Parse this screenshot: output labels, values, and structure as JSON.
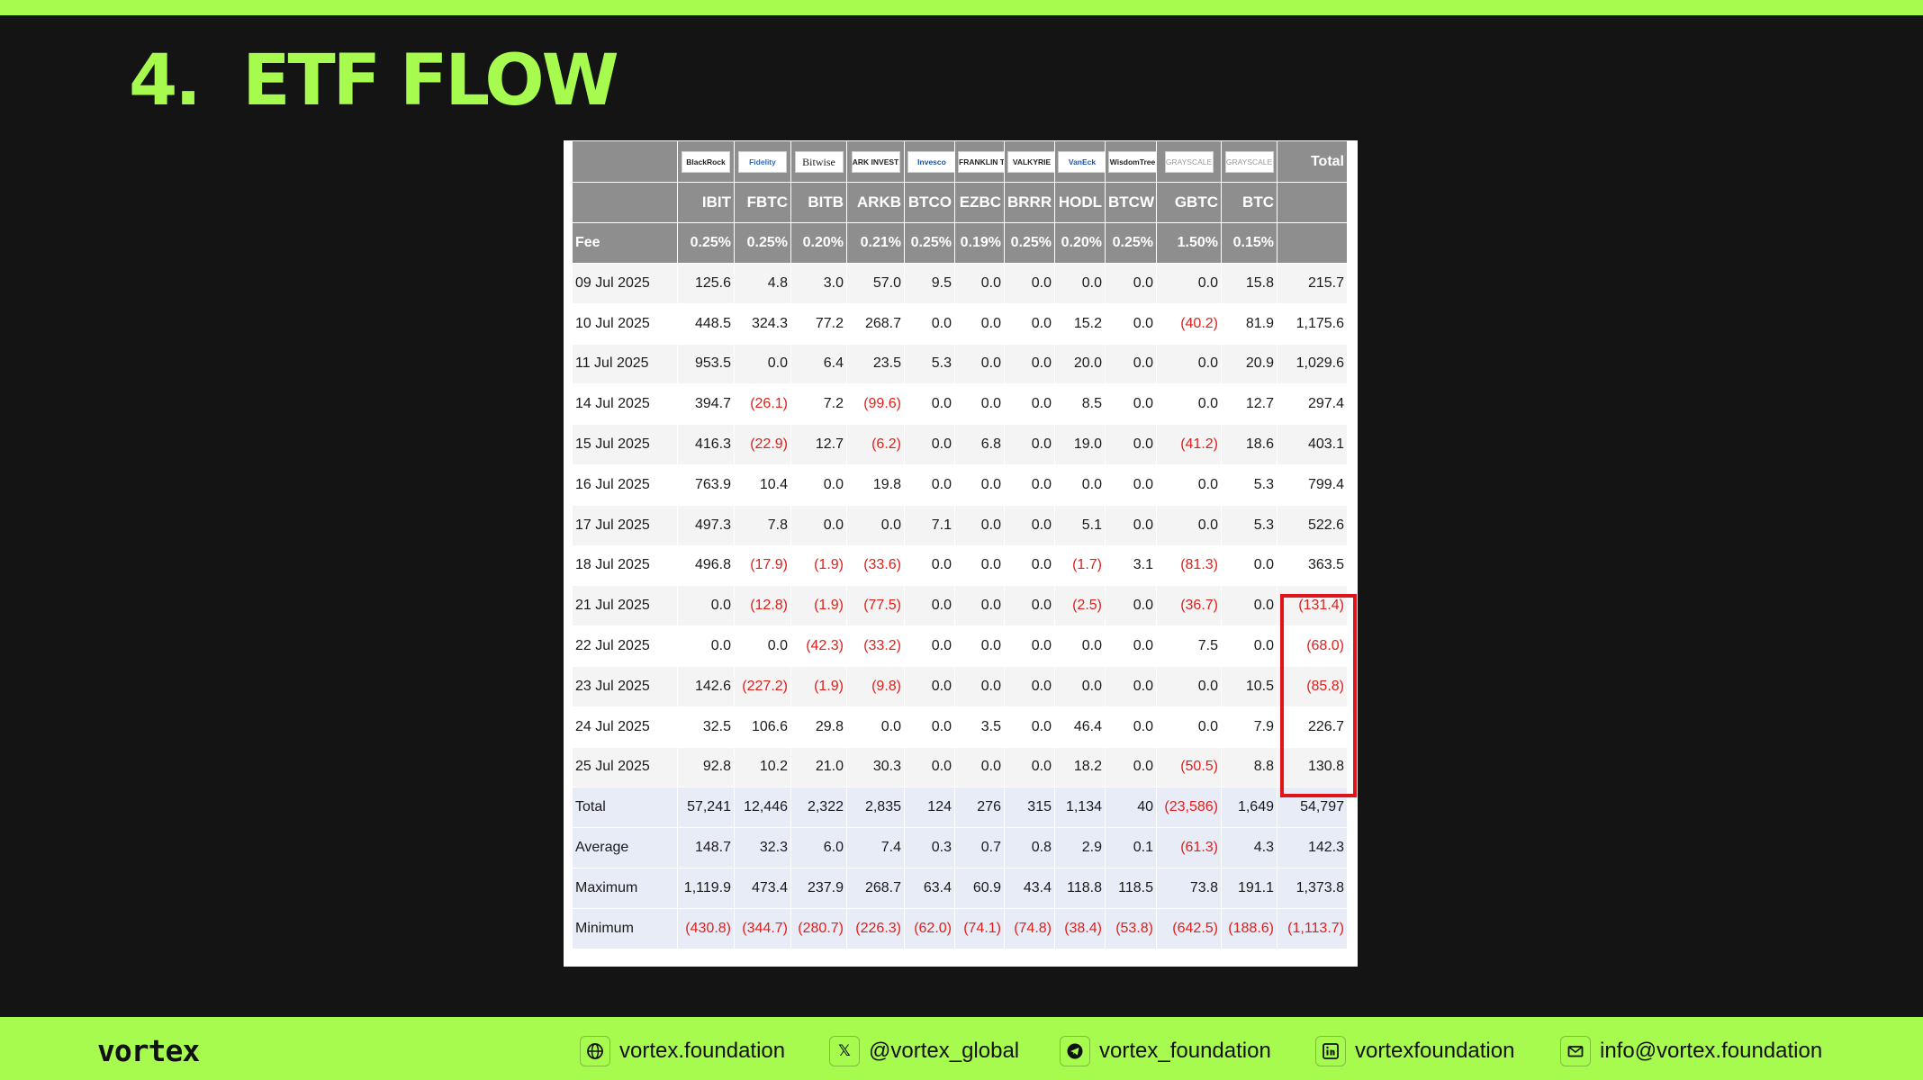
{
  "slide": {
    "title": "4.  ETF FLOW"
  },
  "table": {
    "logos": [
      "BlackRock",
      "Fidelity",
      "Bitwise",
      "ARK INVEST",
      "Invesco",
      "FRANKLIN TEMPLETON",
      "VALKYRIE",
      "VanEck",
      "WisdomTree",
      "GRAYSCALE",
      "GRAYSCALE"
    ],
    "total_header": "Total",
    "tickers": [
      "",
      "IBIT",
      "FBTC",
      "BITB",
      "ARKB",
      "BTCO",
      "EZBC",
      "BRRR",
      "HODL",
      "BTCW",
      "GBTC",
      "BTC",
      ""
    ],
    "fee_row": [
      "Fee",
      "0.25%",
      "0.25%",
      "0.20%",
      "0.21%",
      "0.25%",
      "0.19%",
      "0.25%",
      "0.20%",
      "0.25%",
      "1.50%",
      "0.15%",
      ""
    ],
    "rows": [
      [
        "09 Jul 2025",
        "125.6",
        "4.8",
        "3.0",
        "57.0",
        "9.5",
        "0.0",
        "0.0",
        "0.0",
        "0.0",
        "0.0",
        "15.8",
        "215.7"
      ],
      [
        "10 Jul 2025",
        "448.5",
        "324.3",
        "77.2",
        "268.7",
        "0.0",
        "0.0",
        "0.0",
        "15.2",
        "0.0",
        "(40.2)",
        "81.9",
        "1,175.6"
      ],
      [
        "11 Jul 2025",
        "953.5",
        "0.0",
        "6.4",
        "23.5",
        "5.3",
        "0.0",
        "0.0",
        "20.0",
        "0.0",
        "0.0",
        "20.9",
        "1,029.6"
      ],
      [
        "14 Jul 2025",
        "394.7",
        "(26.1)",
        "7.2",
        "(99.6)",
        "0.0",
        "0.0",
        "0.0",
        "8.5",
        "0.0",
        "0.0",
        "12.7",
        "297.4"
      ],
      [
        "15 Jul 2025",
        "416.3",
        "(22.9)",
        "12.7",
        "(6.2)",
        "0.0",
        "6.8",
        "0.0",
        "19.0",
        "0.0",
        "(41.2)",
        "18.6",
        "403.1"
      ],
      [
        "16 Jul 2025",
        "763.9",
        "10.4",
        "0.0",
        "19.8",
        "0.0",
        "0.0",
        "0.0",
        "0.0",
        "0.0",
        "0.0",
        "5.3",
        "799.4"
      ],
      [
        "17 Jul 2025",
        "497.3",
        "7.8",
        "0.0",
        "0.0",
        "7.1",
        "0.0",
        "0.0",
        "5.1",
        "0.0",
        "0.0",
        "5.3",
        "522.6"
      ],
      [
        "18 Jul 2025",
        "496.8",
        "(17.9)",
        "(1.9)",
        "(33.6)",
        "0.0",
        "0.0",
        "0.0",
        "(1.7)",
        "3.1",
        "(81.3)",
        "0.0",
        "363.5"
      ],
      [
        "21 Jul 2025",
        "0.0",
        "(12.8)",
        "(1.9)",
        "(77.5)",
        "0.0",
        "0.0",
        "0.0",
        "(2.5)",
        "0.0",
        "(36.7)",
        "0.0",
        "(131.4)"
      ],
      [
        "22 Jul 2025",
        "0.0",
        "0.0",
        "(42.3)",
        "(33.2)",
        "0.0",
        "0.0",
        "0.0",
        "0.0",
        "0.0",
        "7.5",
        "0.0",
        "(68.0)"
      ],
      [
        "23 Jul 2025",
        "142.6",
        "(227.2)",
        "(1.9)",
        "(9.8)",
        "0.0",
        "0.0",
        "0.0",
        "0.0",
        "0.0",
        "0.0",
        "10.5",
        "(85.8)"
      ],
      [
        "24 Jul 2025",
        "32.5",
        "106.6",
        "29.8",
        "0.0",
        "0.0",
        "3.5",
        "0.0",
        "46.4",
        "0.0",
        "0.0",
        "7.9",
        "226.7"
      ],
      [
        "25 Jul 2025",
        "92.8",
        "10.2",
        "21.0",
        "30.3",
        "0.0",
        "0.0",
        "0.0",
        "18.2",
        "0.0",
        "(50.5)",
        "8.8",
        "130.8"
      ]
    ],
    "stats": [
      [
        "Total",
        "57,241",
        "12,446",
        "2,322",
        "2,835",
        "124",
        "276",
        "315",
        "1,134",
        "40",
        "(23,586)",
        "1,649",
        "54,797"
      ],
      [
        "Average",
        "148.7",
        "32.3",
        "6.0",
        "7.4",
        "0.3",
        "0.7",
        "0.8",
        "2.9",
        "0.1",
        "(61.3)",
        "4.3",
        "142.3"
      ],
      [
        "Maximum",
        "1,119.9",
        "473.4",
        "237.9",
        "268.7",
        "63.4",
        "60.9",
        "43.4",
        "118.8",
        "118.5",
        "73.8",
        "191.1",
        "1,373.8"
      ],
      [
        "Minimum",
        "(430.8)",
        "(344.7)",
        "(280.7)",
        "(226.3)",
        "(62.0)",
        "(74.1)",
        "(74.8)",
        "(38.4)",
        "(53.8)",
        "(642.5)",
        "(188.6)",
        "(1,113.7)"
      ]
    ]
  },
  "colors": {
    "accent": "#a6fb4e",
    "background": "#141414",
    "negative": "#e0201b",
    "highlight": "#e0141b"
  },
  "footer": {
    "brand": "vortex",
    "contacts": [
      {
        "icon": "globe-icon",
        "text": "vortex.foundation"
      },
      {
        "icon": "x-icon",
        "text": "@vortex_global"
      },
      {
        "icon": "telegram-icon",
        "text": "vortex_foundation"
      },
      {
        "icon": "linkedin-icon",
        "text": "vortexfoundation"
      },
      {
        "icon": "mail-icon",
        "text": "info@vortex.foundation"
      }
    ]
  }
}
